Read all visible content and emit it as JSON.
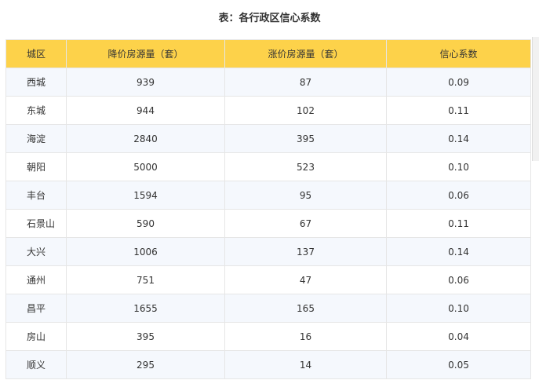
{
  "caption": "表：各行政区信心系数",
  "table": {
    "headers": [
      "城区",
      "降价房源量（套）",
      "涨价房源量（套）",
      "信心系数"
    ],
    "rows": [
      [
        "西城",
        "939",
        "87",
        "0.09"
      ],
      [
        "东城",
        "944",
        "102",
        "0.11"
      ],
      [
        "海淀",
        "2840",
        "395",
        "0.14"
      ],
      [
        "朝阳",
        "5000",
        "523",
        "0.10"
      ],
      [
        "丰台",
        "1594",
        "95",
        "0.06"
      ],
      [
        "石景山",
        "590",
        "67",
        "0.11"
      ],
      [
        "大兴",
        "1006",
        "137",
        "0.14"
      ],
      [
        "通州",
        "751",
        "47",
        "0.06"
      ],
      [
        "昌平",
        "1655",
        "165",
        "0.10"
      ],
      [
        "房山",
        "395",
        "16",
        "0.04"
      ],
      [
        "顺义",
        "295",
        "14",
        "0.05"
      ]
    ]
  },
  "colors": {
    "header_bg": "#fdd24a",
    "row_alt_bg": "#f5f8fd",
    "border": "#e6e6e6",
    "text": "#333333"
  }
}
